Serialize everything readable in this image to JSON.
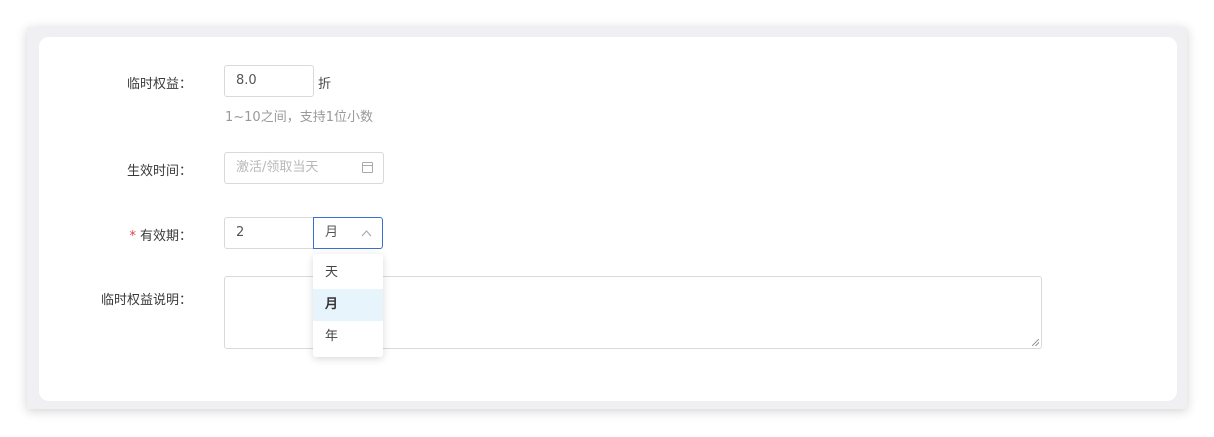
{
  "form": {
    "temp_benefit": {
      "label": "临时权益：",
      "value": "8.0",
      "unit": "折",
      "hint": "1~10之间，支持1位小数"
    },
    "effective_time": {
      "label": "生效时间：",
      "placeholder": "激活/领取当天"
    },
    "validity": {
      "required_mark": "*",
      "label": "有效期：",
      "value": "2",
      "unit_selected": "月",
      "options": [
        "天",
        "月",
        "年"
      ],
      "selected_index": 1
    },
    "description": {
      "label": "临时权益说明："
    }
  },
  "icons": {
    "calendar": "calendar-icon",
    "chevron": "chevron-up-icon"
  },
  "colors": {
    "focus_border": "#3b6fd6",
    "selected_option_bg": "#e8f4fc",
    "required": "#e04040"
  }
}
